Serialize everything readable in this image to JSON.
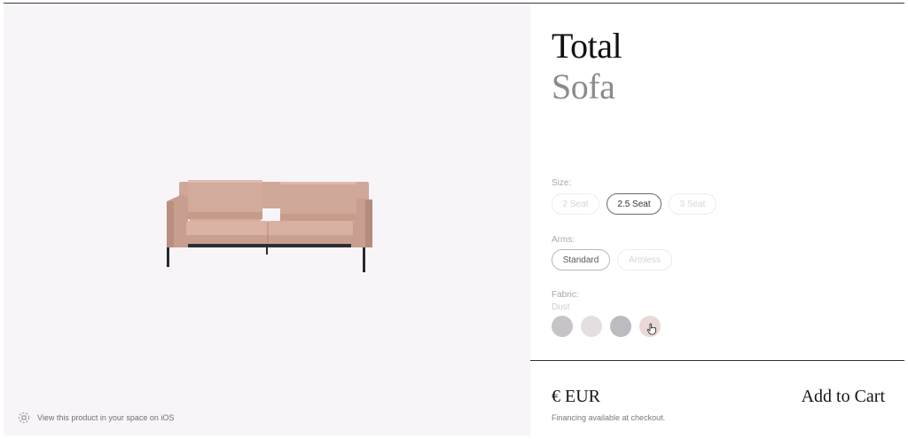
{
  "product": {
    "title_line1": "Total",
    "title_line2": "Sofa"
  },
  "viewer": {
    "ar_link_text": "View this product in your space on iOS",
    "ar_icon": "ar-cube-icon",
    "background_color": "#f8f5f9"
  },
  "options": {
    "size": {
      "label": "Size:",
      "choices": [
        {
          "label": "2 Seat",
          "state": "disabled"
        },
        {
          "label": "2.5 Seat",
          "state": "selected"
        },
        {
          "label": "3 Seat",
          "state": "disabled"
        }
      ]
    },
    "arms": {
      "label": "Arms:",
      "choices": [
        {
          "label": "Standard",
          "state": "enabled"
        },
        {
          "label": "Armless",
          "state": "disabled"
        }
      ]
    },
    "fabric": {
      "label": "Fabric:",
      "selected_name": "Dust",
      "swatches": [
        {
          "color": "#c6c4c6"
        },
        {
          "color": "#e3dfe0"
        },
        {
          "color": "#bcbbc0"
        },
        {
          "color": "#e9d8d5"
        }
      ]
    }
  },
  "footer": {
    "price": "€ EUR",
    "financing": "Financing available at checkout.",
    "add_to_cart": "Add to Cart"
  }
}
